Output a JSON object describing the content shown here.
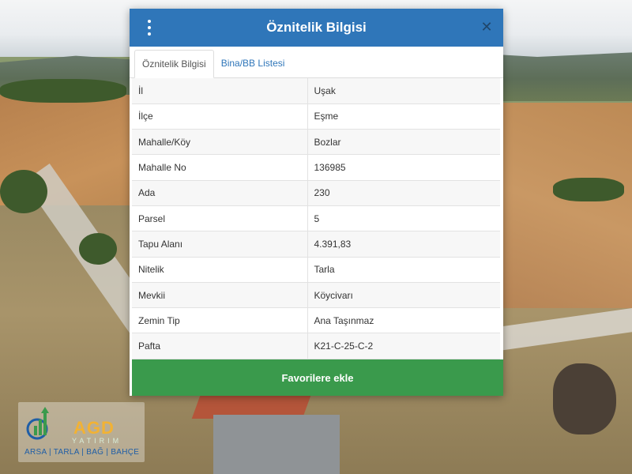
{
  "modal": {
    "title": "Öznitelik Bilgisi",
    "tabs": [
      {
        "label": "Öznitelik Bilgisi",
        "active": true
      },
      {
        "label": "Bina/BB Listesi",
        "active": false
      }
    ],
    "rows": [
      {
        "key": "İl",
        "value": "Uşak"
      },
      {
        "key": "İlçe",
        "value": "Eşme"
      },
      {
        "key": "Mahalle/Köy",
        "value": "Bozlar"
      },
      {
        "key": "Mahalle No",
        "value": "136985"
      },
      {
        "key": "Ada",
        "value": "230"
      },
      {
        "key": "Parsel",
        "value": "5"
      },
      {
        "key": "Tapu Alanı",
        "value": "4.391,83"
      },
      {
        "key": "Nitelik",
        "value": "Tarla"
      },
      {
        "key": "Mevkii",
        "value": "Köycivarı"
      },
      {
        "key": "Zemin Tip",
        "value": "Ana Taşınmaz"
      },
      {
        "key": "Pafta",
        "value": "K21-C-25-C-2"
      }
    ],
    "favorite_button": "Favorilere ekle"
  },
  "logo": {
    "name": "AGD",
    "sub": "YATIRIM",
    "tagline": "ARSA | TARLA | BAĞ | BAHÇE"
  },
  "colors": {
    "header": "#2f76b9",
    "favorite_button": "#3a9a4c",
    "tab_link": "#2f76b9",
    "logo_accent": "#f2b233"
  },
  "icons": {
    "menu": "vertical-ellipsis-icon",
    "close": "close-icon"
  }
}
